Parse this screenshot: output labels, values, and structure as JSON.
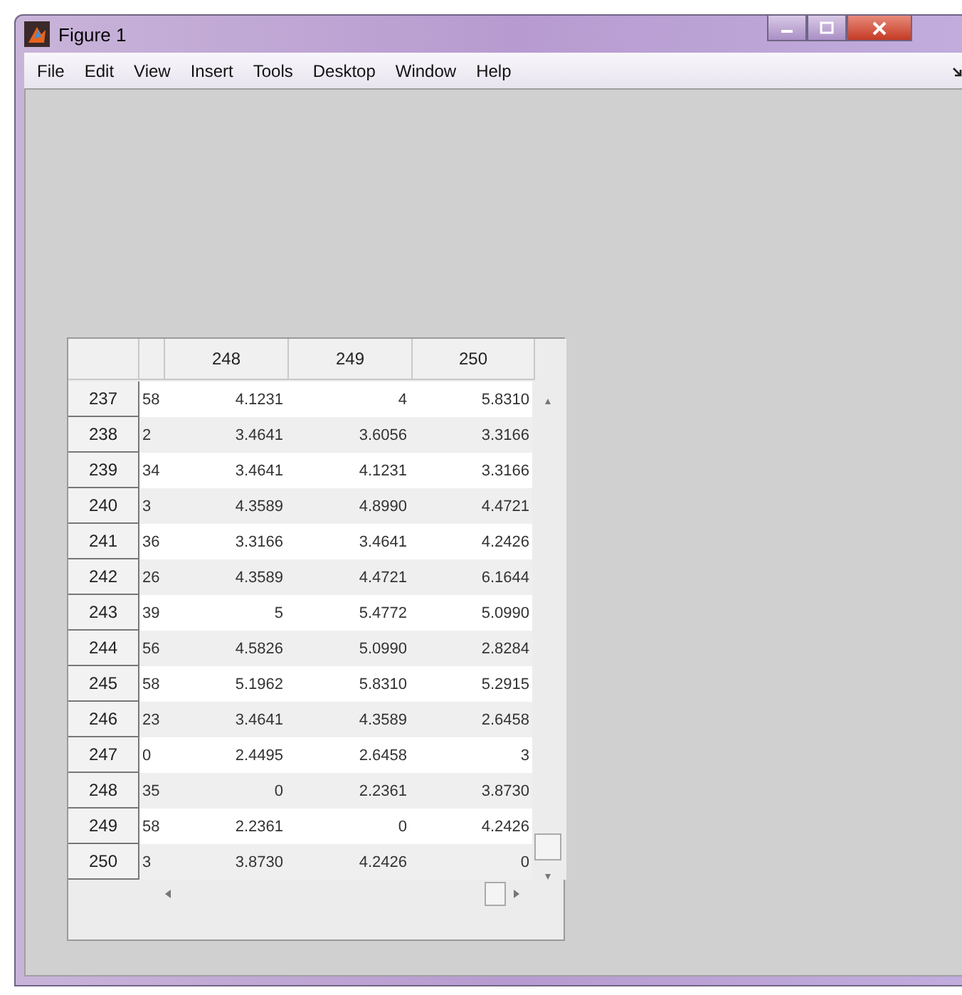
{
  "window": {
    "title": "Figure 1"
  },
  "menu": [
    "File",
    "Edit",
    "View",
    "Insert",
    "Tools",
    "Desktop",
    "Window",
    "Help"
  ],
  "table": {
    "columns": [
      "248",
      "249",
      "250"
    ],
    "rows": [
      {
        "label": "237",
        "cells": [
          "58",
          "4.1231",
          "4",
          "5.8310"
        ]
      },
      {
        "label": "238",
        "cells": [
          "2",
          "3.4641",
          "3.6056",
          "3.3166"
        ]
      },
      {
        "label": "239",
        "cells": [
          "34",
          "3.4641",
          "4.1231",
          "3.3166"
        ]
      },
      {
        "label": "240",
        "cells": [
          "3",
          "4.3589",
          "4.8990",
          "4.4721"
        ]
      },
      {
        "label": "241",
        "cells": [
          "36",
          "3.3166",
          "3.4641",
          "4.2426"
        ]
      },
      {
        "label": "242",
        "cells": [
          "26",
          "4.3589",
          "4.4721",
          "6.1644"
        ]
      },
      {
        "label": "243",
        "cells": [
          "39",
          "5",
          "5.4772",
          "5.0990"
        ]
      },
      {
        "label": "244",
        "cells": [
          "56",
          "4.5826",
          "5.0990",
          "2.8284"
        ]
      },
      {
        "label": "245",
        "cells": [
          "58",
          "5.1962",
          "5.8310",
          "5.2915"
        ]
      },
      {
        "label": "246",
        "cells": [
          "23",
          "3.4641",
          "4.3589",
          "2.6458"
        ]
      },
      {
        "label": "247",
        "cells": [
          "0",
          "2.4495",
          "2.6458",
          "3"
        ]
      },
      {
        "label": "248",
        "cells": [
          "35",
          "0",
          "2.2361",
          "3.8730"
        ]
      },
      {
        "label": "249",
        "cells": [
          "58",
          "2.2361",
          "0",
          "4.2426"
        ]
      },
      {
        "label": "250",
        "cells": [
          "3",
          "3.8730",
          "4.2426",
          "0"
        ]
      }
    ]
  }
}
